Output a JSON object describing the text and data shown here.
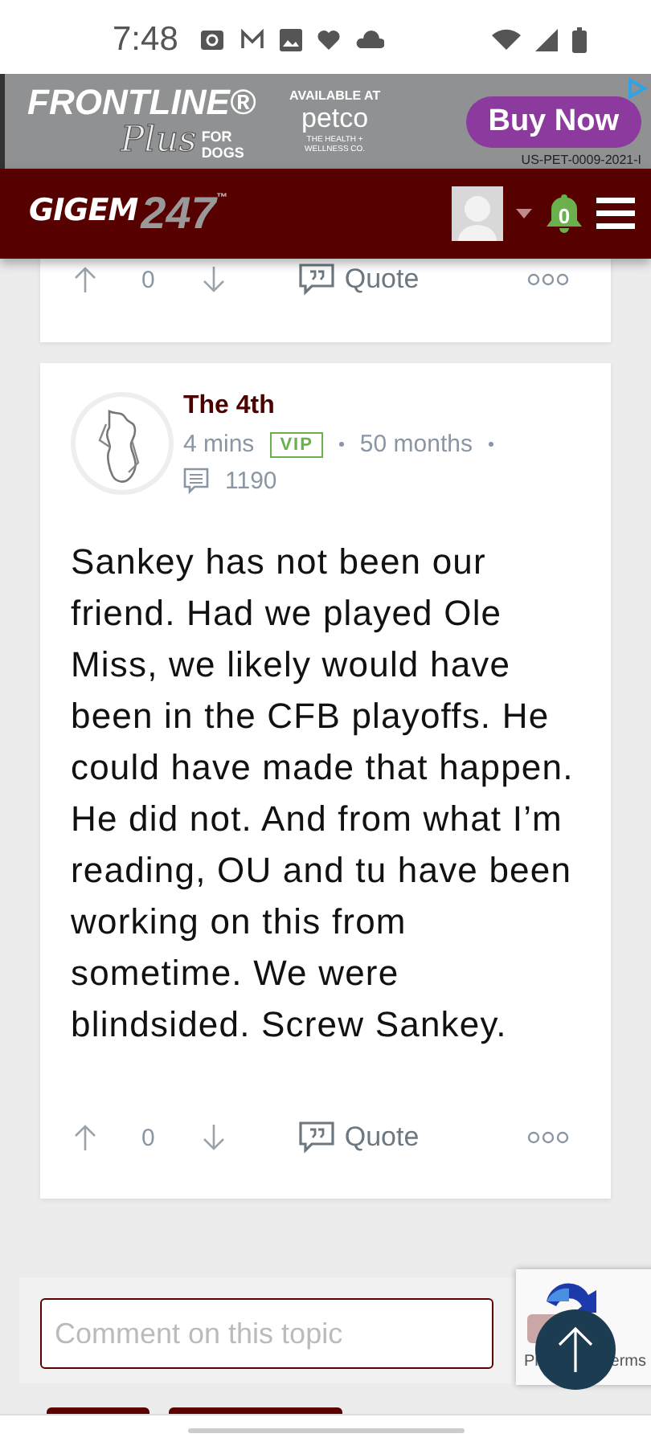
{
  "status_bar": {
    "time": "7:48"
  },
  "ad": {
    "brand": "FRONTLINE®",
    "product": "Plus",
    "product_suffix": "FOR DOGS",
    "retailer_label": "AVAILABLE AT",
    "retailer": "petco",
    "retailer_tagline": "THE HEALTH + WELLNESS CO.",
    "button": "Buy Now",
    "code": "US-PET-0009-2021-I"
  },
  "header": {
    "logo_word": "GIGEM",
    "logo_number": "247",
    "logo_mark": "™",
    "notifications": "0"
  },
  "posts": [
    {
      "votes": "0",
      "quote": "Quote"
    },
    {
      "author": "The 4th",
      "time": "4 mins",
      "badge": "VIP",
      "tenure": "50 months",
      "post_count": "1190",
      "body": "Sankey has not been our friend. Had we played Ole Miss, we likely would have been in the CFB playoffs. He could have made that happen. He did not. And from what I’m reading, OU and tu have been working on this from sometime. We were blindsided. Screw Sankey.",
      "votes": "0",
      "quote": "Quote"
    }
  ],
  "comment": {
    "placeholder": "Comment on this topic"
  },
  "recaptcha": {
    "left_text": "Pr",
    "right_text": "erms"
  }
}
